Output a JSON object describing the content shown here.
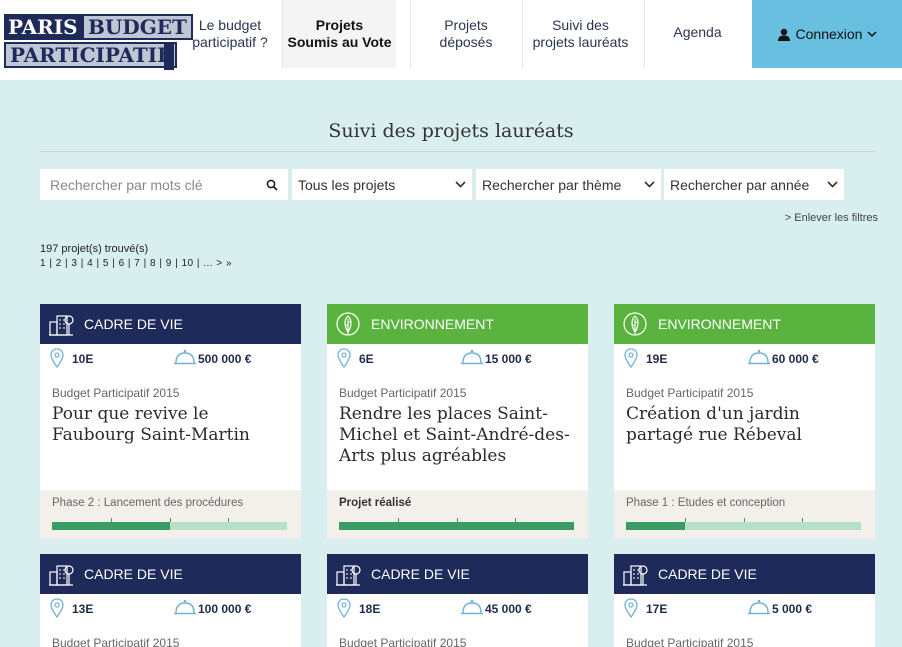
{
  "header": {
    "logo_line1a": "PARIS",
    "logo_line1b": "BUDGET",
    "logo_line2": "PARTICIPATIF",
    "nav": [
      {
        "label_top": "Le budget",
        "label_bottom": "participatif ?"
      },
      {
        "label_top": "Projets",
        "label_bottom": "Soumis au Vote"
      },
      {
        "label_top": "Projets",
        "label_bottom": "déposés"
      },
      {
        "label_top": "Suivi des",
        "label_bottom": "projets lauréats"
      },
      {
        "label_top": "Agenda",
        "label_bottom": ""
      }
    ],
    "login_label": "Connexion",
    "login_icon": "user-icon"
  },
  "main": {
    "title": "Suivi des projets lauréats",
    "search_placeholder": "Rechercher par mots clé",
    "filter_projects": "Tous les projets",
    "filter_theme": "Rechercher par thème",
    "filter_year": "Rechercher par année",
    "remove_filters": "> Enlever les filtres",
    "count": "197 projet(s) trouvé(s)",
    "pagination": "1 | 2 | 3 | 4 | 5 | 6 | 7 | 8 | 9 | 10 | ... > »"
  },
  "colors": {
    "navy": "#1d2a5a",
    "green": "#5ab33e",
    "login_bg": "#69bfdf",
    "page_bg": "#d9eeee",
    "progress_done": "#3a9c65",
    "progress_todo": "#b3e2c8"
  },
  "cards": [
    {
      "theme": "CADRE DE VIE",
      "theme_icon": "city-icon",
      "arrondissement": "10E",
      "budget": "500 000 €",
      "year": "Budget Participatif 2015",
      "title": "Pour que revive le Faubourg Saint-Martin",
      "phase": "Phase 2 : Lancement des procédures",
      "progress": 0.5
    },
    {
      "theme": "ENVIRONNEMENT",
      "theme_icon": "leaf-icon",
      "arrondissement": "6E",
      "budget": "15 000 €",
      "year": "Budget Participatif 2015",
      "title": "Rendre les places Saint-Michel et Saint-André-des-Arts plus agréables",
      "phase": "Projet réalisé",
      "progress": 1.0
    },
    {
      "theme": "ENVIRONNEMENT",
      "theme_icon": "leaf-icon",
      "arrondissement": "19E",
      "budget": "60 000 €",
      "year": "Budget Participatif 2015",
      "title": "Création d'un jardin partagé rue Rébeval",
      "phase": "Phase 1 : Etudes et conception",
      "progress": 0.25
    },
    {
      "theme": "CADRE DE VIE",
      "theme_icon": "city-icon",
      "arrondissement": "13E",
      "budget": "100 000 €",
      "year": "Budget Participatif 2015"
    },
    {
      "theme": "CADRE DE VIE",
      "theme_icon": "city-icon",
      "arrondissement": "18E",
      "budget": "45 000 €",
      "year": "Budget Participatif 2015"
    },
    {
      "theme": "CADRE DE VIE",
      "theme_icon": "city-icon",
      "arrondissement": "17E",
      "budget": "5 000 €",
      "year": "Budget Participatif 2015"
    }
  ]
}
